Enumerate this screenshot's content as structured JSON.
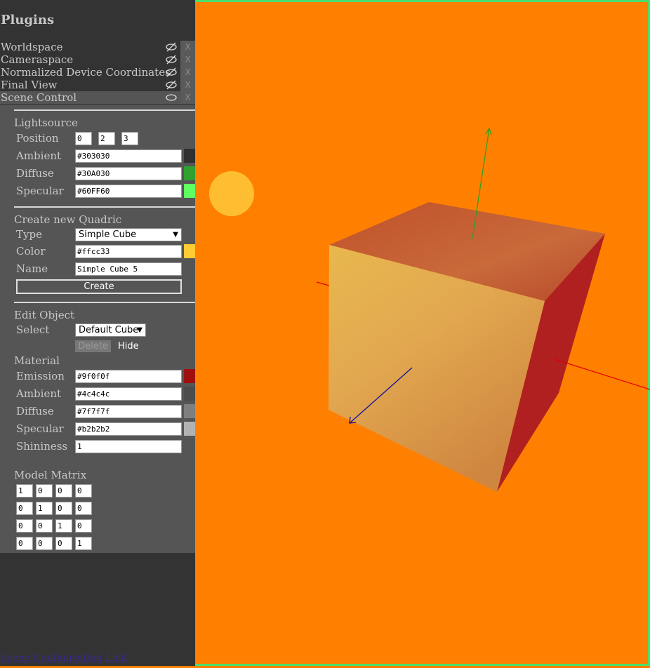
{
  "plugins": {
    "title": "Plugins",
    "items": [
      {
        "label": "Worldspace",
        "visible": false,
        "close": "X"
      },
      {
        "label": "Cameraspace",
        "visible": false,
        "close": "X"
      },
      {
        "label": "Normalized Device Coordinates",
        "visible": false,
        "close": "X"
      },
      {
        "label": "Final View",
        "visible": false,
        "close": "X"
      },
      {
        "label": "Scene Control",
        "visible": true,
        "close": "X"
      }
    ]
  },
  "lightsource": {
    "title": "Lightsource",
    "position_label": "Position",
    "position": [
      "0",
      "2",
      "3"
    ],
    "ambient_label": "Ambient",
    "ambient": "#303030",
    "ambient_color": "#303030",
    "diffuse_label": "Diffuse",
    "diffuse": "#30A030",
    "diffuse_color": "#30A030",
    "specular_label": "Specular",
    "specular": "#60FF60",
    "specular_color": "#60FF60"
  },
  "quadric": {
    "title": "Create new Quadric",
    "type_label": "Type",
    "type": "Simple Cube",
    "color_label": "Color",
    "color": "#ffcc33",
    "color_swatch": "#ffcc33",
    "name_label": "Name",
    "name": "Simple Cube 5",
    "create_label": "Create"
  },
  "edit": {
    "title": "Edit Object",
    "select_label": "Select",
    "selected": "Default Cube",
    "delete_label": "Delete",
    "hide_label": "Hide"
  },
  "material": {
    "title": "Material",
    "emission_label": "Emission",
    "emission": "#9f0f0f",
    "emission_color": "#9f0f0f",
    "ambient_label": "Ambient",
    "ambient": "#4c4c4c",
    "ambient_color": "#4c4c4c",
    "diffuse_label": "Diffuse",
    "diffuse": "#7f7f7f",
    "diffuse_color": "#7f7f7f",
    "specular_label": "Specular",
    "specular": "#b2b2b2",
    "specular_color": "#b2b2b2",
    "shininess_label": "Shininess",
    "shininess": "1"
  },
  "model_matrix": {
    "title": "Model Matrix",
    "rows": [
      [
        "1",
        "0",
        "0",
        "0"
      ],
      [
        "0",
        "1",
        "0",
        "0"
      ],
      [
        "0",
        "0",
        "1",
        "0"
      ],
      [
        "0",
        "0",
        "0",
        "1"
      ]
    ]
  },
  "footer": {
    "link": "Scene Configuration Link"
  },
  "viewport": {
    "background": "#ff8000",
    "border_color": "#4ade6a"
  }
}
